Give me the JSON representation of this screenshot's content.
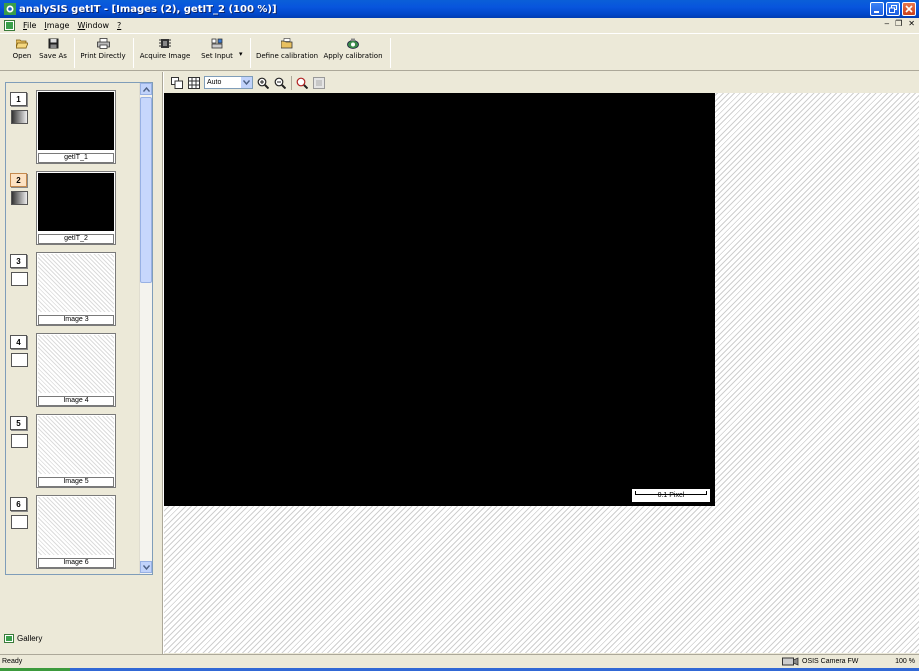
{
  "window": {
    "title": "analySIS getIT - [Images (2), getIT_2 (100 %)]"
  },
  "menu": {
    "items": [
      {
        "label": "File",
        "key": "F",
        "rest": "ile"
      },
      {
        "label": "Image",
        "key": "I",
        "rest": "mage"
      },
      {
        "label": "Window",
        "key": "W",
        "rest": "indow"
      },
      {
        "label": "?",
        "key": "?",
        "rest": ""
      }
    ]
  },
  "toolbar": {
    "open": "Open",
    "save_as": "Save As",
    "print_directly": "Print Directly",
    "acquire_image": "Acquire Image",
    "set_input": "Set Input",
    "define_calibration": "Define calibration",
    "apply_calibration": "Apply calibration"
  },
  "gallery": {
    "tab_label": "Gallery",
    "slots": [
      {
        "number": "1",
        "label": "getIT_1",
        "filled": true
      },
      {
        "number": "2",
        "label": "getIT_2",
        "filled": true,
        "active": true
      },
      {
        "number": "3",
        "label": "Image 3",
        "filled": false
      },
      {
        "number": "4",
        "label": "Image 4",
        "filled": false
      },
      {
        "number": "5",
        "label": "Image 5",
        "filled": false
      },
      {
        "number": "6",
        "label": "Image 6",
        "filled": false
      }
    ]
  },
  "view": {
    "zoom_mode": "Auto",
    "scalebar_label": "0.1 Pixel"
  },
  "status": {
    "ready": "Ready",
    "camera": "OSIS Camera FW",
    "zoom": "100 %"
  },
  "colors": {
    "titlebar": "#0055e5",
    "image_background": "#000000",
    "active_slot": "#fde2c2"
  }
}
